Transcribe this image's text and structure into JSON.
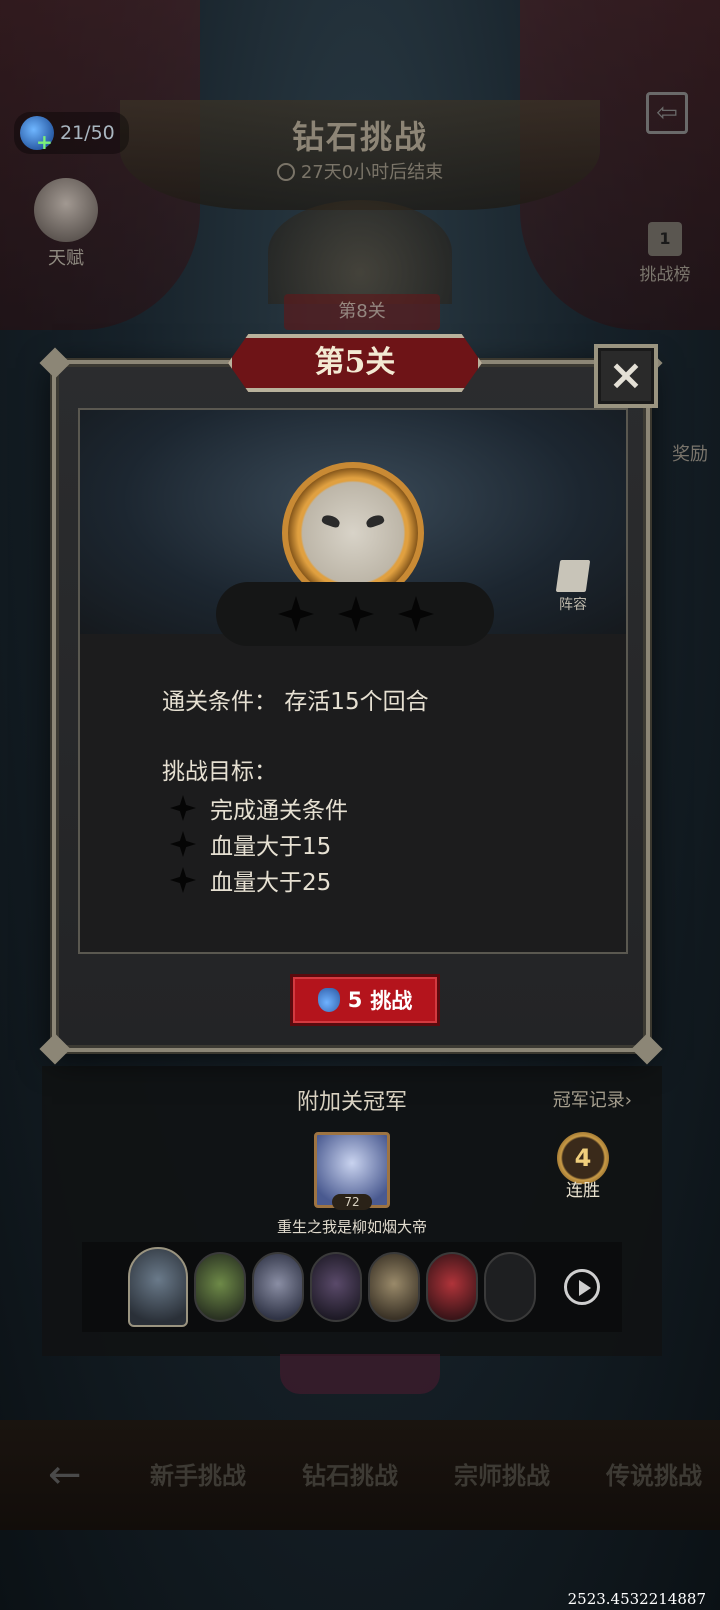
{
  "hud": {
    "energy": "21/50",
    "talent_label": "天赋",
    "rank_label": "挑战榜",
    "rank_badge": "1",
    "reward_label": "奖励"
  },
  "event": {
    "title": "钻石挑战",
    "timer": "27天0小时后结束",
    "locked_stage": "第8关"
  },
  "modal": {
    "stage_title": "第5关",
    "close_label": "×",
    "lineup_label": "阵容",
    "clear_condition": "通关条件：  存活15个回合",
    "goals_title": "挑战目标：",
    "goals": [
      "完成通关条件",
      "血量大于15",
      "血量大于25"
    ],
    "challenge_cost": "5",
    "challenge_label": "挑战",
    "stars_earned": 0,
    "stars_total": 3
  },
  "bonus": {
    "title": "附加关冠军",
    "record_link": "冠军记录›",
    "champion_level": "72",
    "champion_name": "重生之我是柳如烟大帝",
    "streak_count": "4",
    "streak_label": "连胜"
  },
  "nav": {
    "back": "←",
    "tabs": [
      "新手挑战",
      "钻石挑战",
      "宗师挑战",
      "传说挑战"
    ]
  },
  "footer": {
    "build": "2523.4532214887"
  }
}
